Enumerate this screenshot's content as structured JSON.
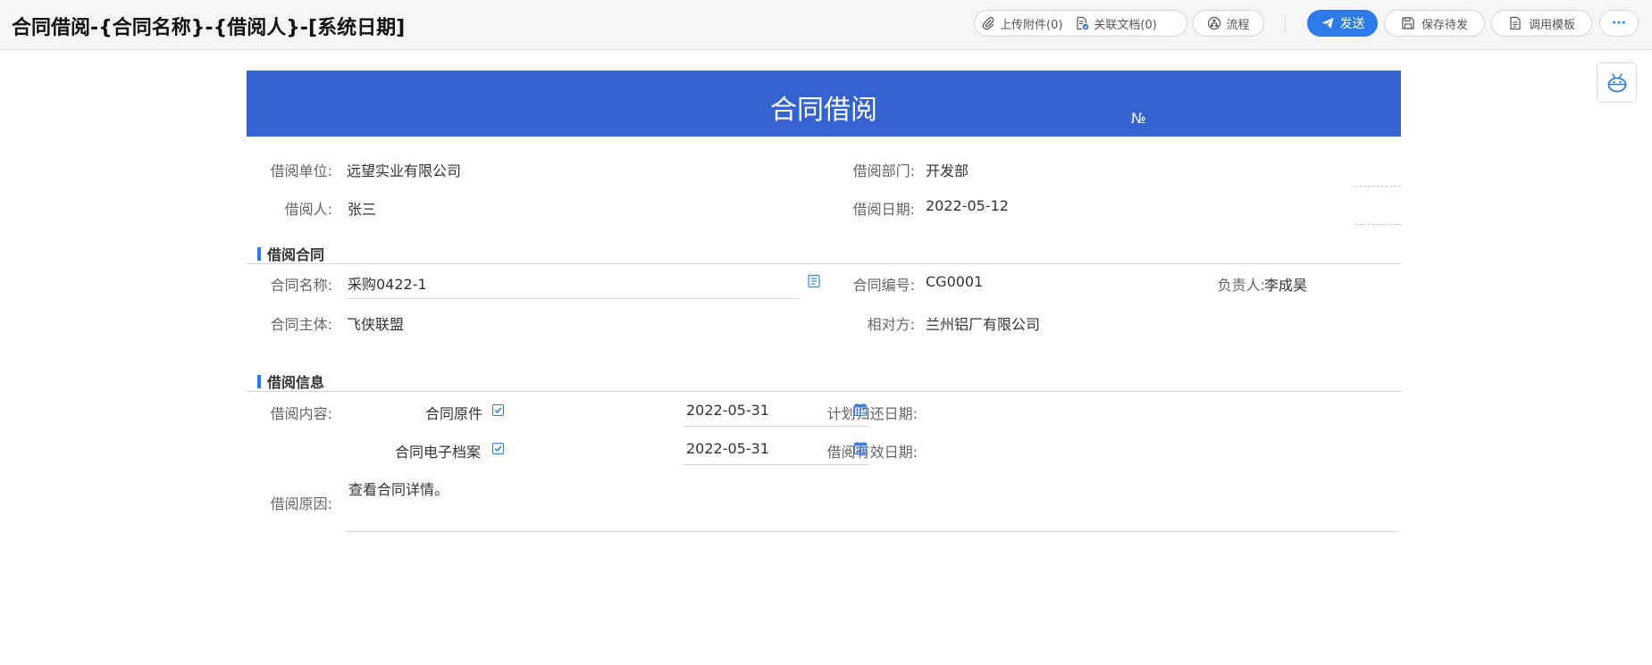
{
  "toolbar": {
    "title": "合同借阅-{合同名称}-{借阅人}-[系统日期]",
    "upload_label": "上传附件(0)",
    "link_doc_label": "关联文档(0)",
    "flow_label": "流程",
    "send_label": "发送",
    "save_label": "保存待发",
    "template_label": "调用模板",
    "more_label": "···"
  },
  "form": {
    "title": "合同借阅",
    "number_label": "№",
    "basic": {
      "unit_label": "借阅单位:",
      "unit_value": "远望实业有限公司",
      "dept_label": "借阅部门:",
      "dept_value": "开发部",
      "person_label": "借阅人:",
      "person_value": "张三",
      "date_label": "借阅日期:",
      "date_value": "2022-05-12"
    },
    "contract_section": {
      "title": "借阅合同",
      "name_label": "合同名称:",
      "name_value": "采购0422-1",
      "code_label": "合同编号:",
      "code_value": "CG0001",
      "owner_label": "负责人:",
      "owner_value": "李成昊",
      "subject_label": "合同主体:",
      "subject_value": "飞侠联盟",
      "counterparty_label": "相对方:",
      "counterparty_value": "兰州铝厂有限公司"
    },
    "info_section": {
      "title": "借阅信息",
      "content_label": "借阅内容:",
      "original_label": "合同原件",
      "original_checked": true,
      "electronic_label": "合同电子档案",
      "electronic_checked": true,
      "return_date_label": "计划归还日期:",
      "return_date_value": "2022-05-31",
      "valid_date_label": "借阅有效日期:",
      "valid_date_value": "2022-05-31",
      "reason_label": "借阅原因:",
      "reason_value": "查看合同详情。"
    }
  },
  "colors": {
    "header_blue": "#3463cf",
    "accent_blue": "#2d7be8"
  }
}
